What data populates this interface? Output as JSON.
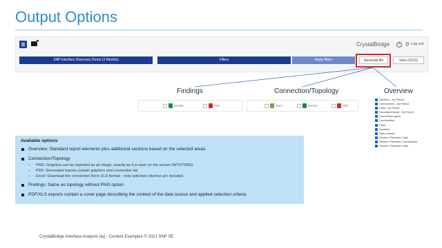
{
  "slide": {
    "title": "Output Options",
    "footer": "CrystalBridge Interface Analysis (Ia) - Content Examples © 2021 SNP SE"
  },
  "app": {
    "brand": "CrystalBridge",
    "help_icon": "question-mark-icon",
    "logout_label": "Log out",
    "demo_bar_label": "SNP Interface Discovery Demo (3 Months)",
    "filters_label": "Filters",
    "apply_filters_label": "Apply filters",
    "generate_file_label": "Generate file",
    "view_label": "View (11/11)",
    "colors": {
      "navy": "#1d3c8f",
      "apply": "#6d87c7",
      "highlight": "#d0282e"
    }
  },
  "sections": {
    "findings": {
      "title": "Findings",
      "options": [
        {
          "label": "EXCEL",
          "icon": "excel-icon",
          "color": "#1f8a3b"
        },
        {
          "label": "PDF",
          "icon": "pdf-icon",
          "color": "#d0282e"
        }
      ]
    },
    "topology": {
      "title": "Connection/Topology",
      "options": [
        {
          "label": "PNG",
          "icon": "png-icon",
          "color": "#6aa84f"
        },
        {
          "label": "EXCEL",
          "icon": "excel-icon",
          "color": "#1f8a3b"
        },
        {
          "label": "PDF",
          "icon": "pdf-icon",
          "color": "#d0282e"
        }
      ]
    },
    "overview": {
      "title": "Overview",
      "items": [
        "Systems - by Period",
        "Connections - by Period",
        "Calls - by Period",
        "Quantity/Volume - by Period",
        "Connection types",
        "Connections",
        "Calls",
        "Systems",
        "Data volume",
        "Sender / Receiver Calls",
        "Sender / Receiver Connections",
        "Sender / Receiver Calls"
      ]
    }
  },
  "info": {
    "title": "Available options",
    "bullets": [
      {
        "text": "Overview: Standard report elements plus additional sections based on the selected areas",
        "subs": []
      },
      {
        "text": "Connection/Topology",
        "subs": [
          "PNG: Graphics can be exported as an image, exactly as it is seen on the screen (WYSYWIG)",
          "PDF: Generated reports contain graphics and connection list",
          "Excel: Download the connection list in XLS format – only selected columns are included"
        ]
      },
      {
        "text": "Findings: Same as topology without PNG option",
        "subs": []
      },
      {
        "text": "PDF/XLS exports contain a cover page describing the context of the data source and applied selection criteria",
        "subs": []
      }
    ]
  }
}
